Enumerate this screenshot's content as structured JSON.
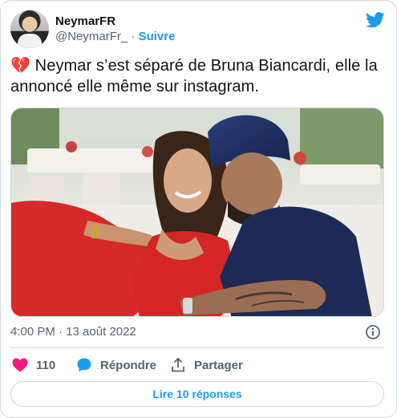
{
  "author": {
    "display_name": "NeymarFR",
    "handle": "@NeymarFr_",
    "separator": " · ",
    "follow_label": "Suivre"
  },
  "tweet": {
    "emoji": "💔",
    "text": " Neymar s’est séparé de Bruna Biancardi, elle la annoncé elle même sur instagram.",
    "timestamp": "4:00 PM · 13 août 2022"
  },
  "actions": {
    "like_count": "110",
    "reply_label": "Répondre",
    "share_label": "Partager"
  },
  "read_replies_label": "Lire 10 réponses",
  "colors": {
    "accent": "#1d9bf0",
    "like": "#f91880",
    "muted": "#536471",
    "border": "#cfd9de"
  },
  "icons": [
    "twitter-bird-icon",
    "info-icon",
    "heart-icon",
    "reply-bubble-icon",
    "share-icon",
    "broken-heart-emoji"
  ]
}
